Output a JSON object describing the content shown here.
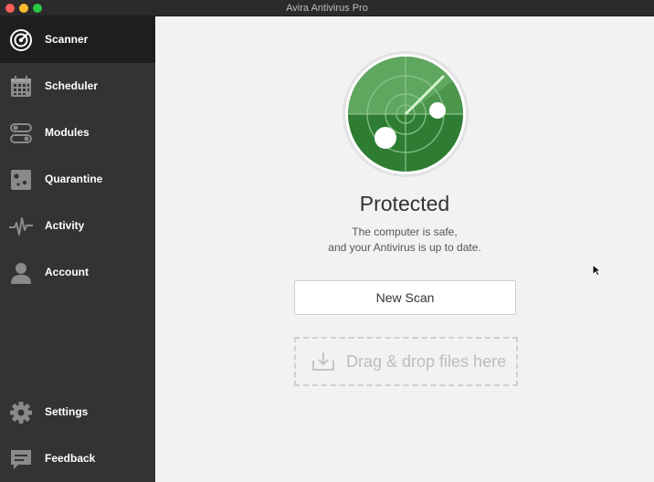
{
  "window": {
    "title": "Avira Antivirus Pro"
  },
  "sidebar": {
    "items": [
      {
        "label": "Scanner",
        "icon": "radar-icon",
        "active": true
      },
      {
        "label": "Scheduler",
        "icon": "calendar-icon"
      },
      {
        "label": "Modules",
        "icon": "toggles-icon"
      },
      {
        "label": "Quarantine",
        "icon": "quarantine-box-icon"
      },
      {
        "label": "Activity",
        "icon": "pulse-icon"
      },
      {
        "label": "Account",
        "icon": "user-icon"
      }
    ],
    "bottom_items": [
      {
        "label": "Settings",
        "icon": "gear-icon"
      },
      {
        "label": "Feedback",
        "icon": "chat-bubble-icon"
      }
    ]
  },
  "main": {
    "status_title": "Protected",
    "status_line1": "The computer is safe,",
    "status_line2": "and your Antivirus is up to date.",
    "scan_button_label": "New Scan",
    "drop_label": "Drag & drop files here"
  },
  "colors": {
    "accent_green": "#2f7d32",
    "radar_light": "#5aa35a",
    "sidebar_bg": "#333333",
    "sidebar_active": "#1e1e1e",
    "main_bg": "#f2f2f2"
  }
}
